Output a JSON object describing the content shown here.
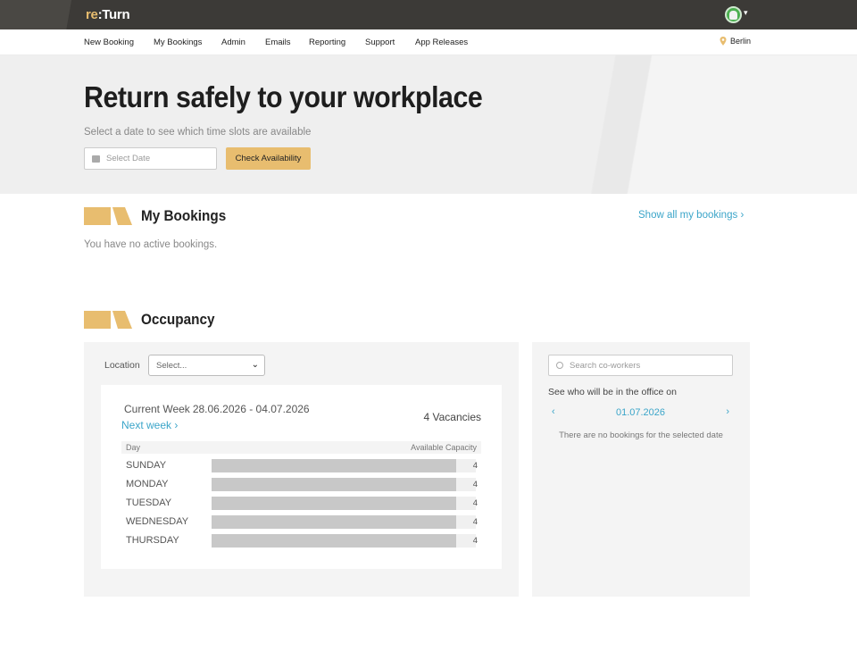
{
  "app": {
    "logo_re": "re",
    "logo_turn": ":Turn"
  },
  "nav": {
    "items": [
      "New Booking",
      "My Bookings",
      "Admin",
      "Emails",
      "Reporting",
      "Support",
      "App Releases"
    ],
    "location": "Berlin"
  },
  "hero": {
    "title": "Return safely to your workplace",
    "subtitle": "Select a date to see which time slots are available",
    "date_placeholder": "Select Date",
    "check_button": "Check Availability"
  },
  "my_bookings": {
    "title": "My Bookings",
    "show_all": "Show all my bookings",
    "empty": "You have no active bookings."
  },
  "occupancy": {
    "title": "Occupancy",
    "location_label": "Location",
    "location_select": "Select...",
    "current_week_label": "Current Week",
    "week_range": "28.06.2026 - 04.07.2026",
    "next_week": "Next week",
    "vacancies": "4 Vacancies",
    "col_day": "Day",
    "col_capacity": "Available Capacity",
    "days": [
      {
        "name": "SUNDAY",
        "value": "4",
        "fill": 1.0
      },
      {
        "name": "MONDAY",
        "value": "4",
        "fill": 1.0
      },
      {
        "name": "TUESDAY",
        "value": "4",
        "fill": 1.0
      },
      {
        "name": "WEDNESDAY",
        "value": "4",
        "fill": 1.0
      },
      {
        "name": "THURSDAY",
        "value": "4",
        "fill": 1.0
      }
    ]
  },
  "coworkers": {
    "search_placeholder": "Search co-workers",
    "see_who": "See who will be in the office on",
    "date": "01.07.2026",
    "empty": "There are no bookings for the selected date"
  },
  "colors": {
    "accent": "#e8bd6f",
    "link": "#3ba5c9",
    "topbar": "#3c3a37"
  }
}
